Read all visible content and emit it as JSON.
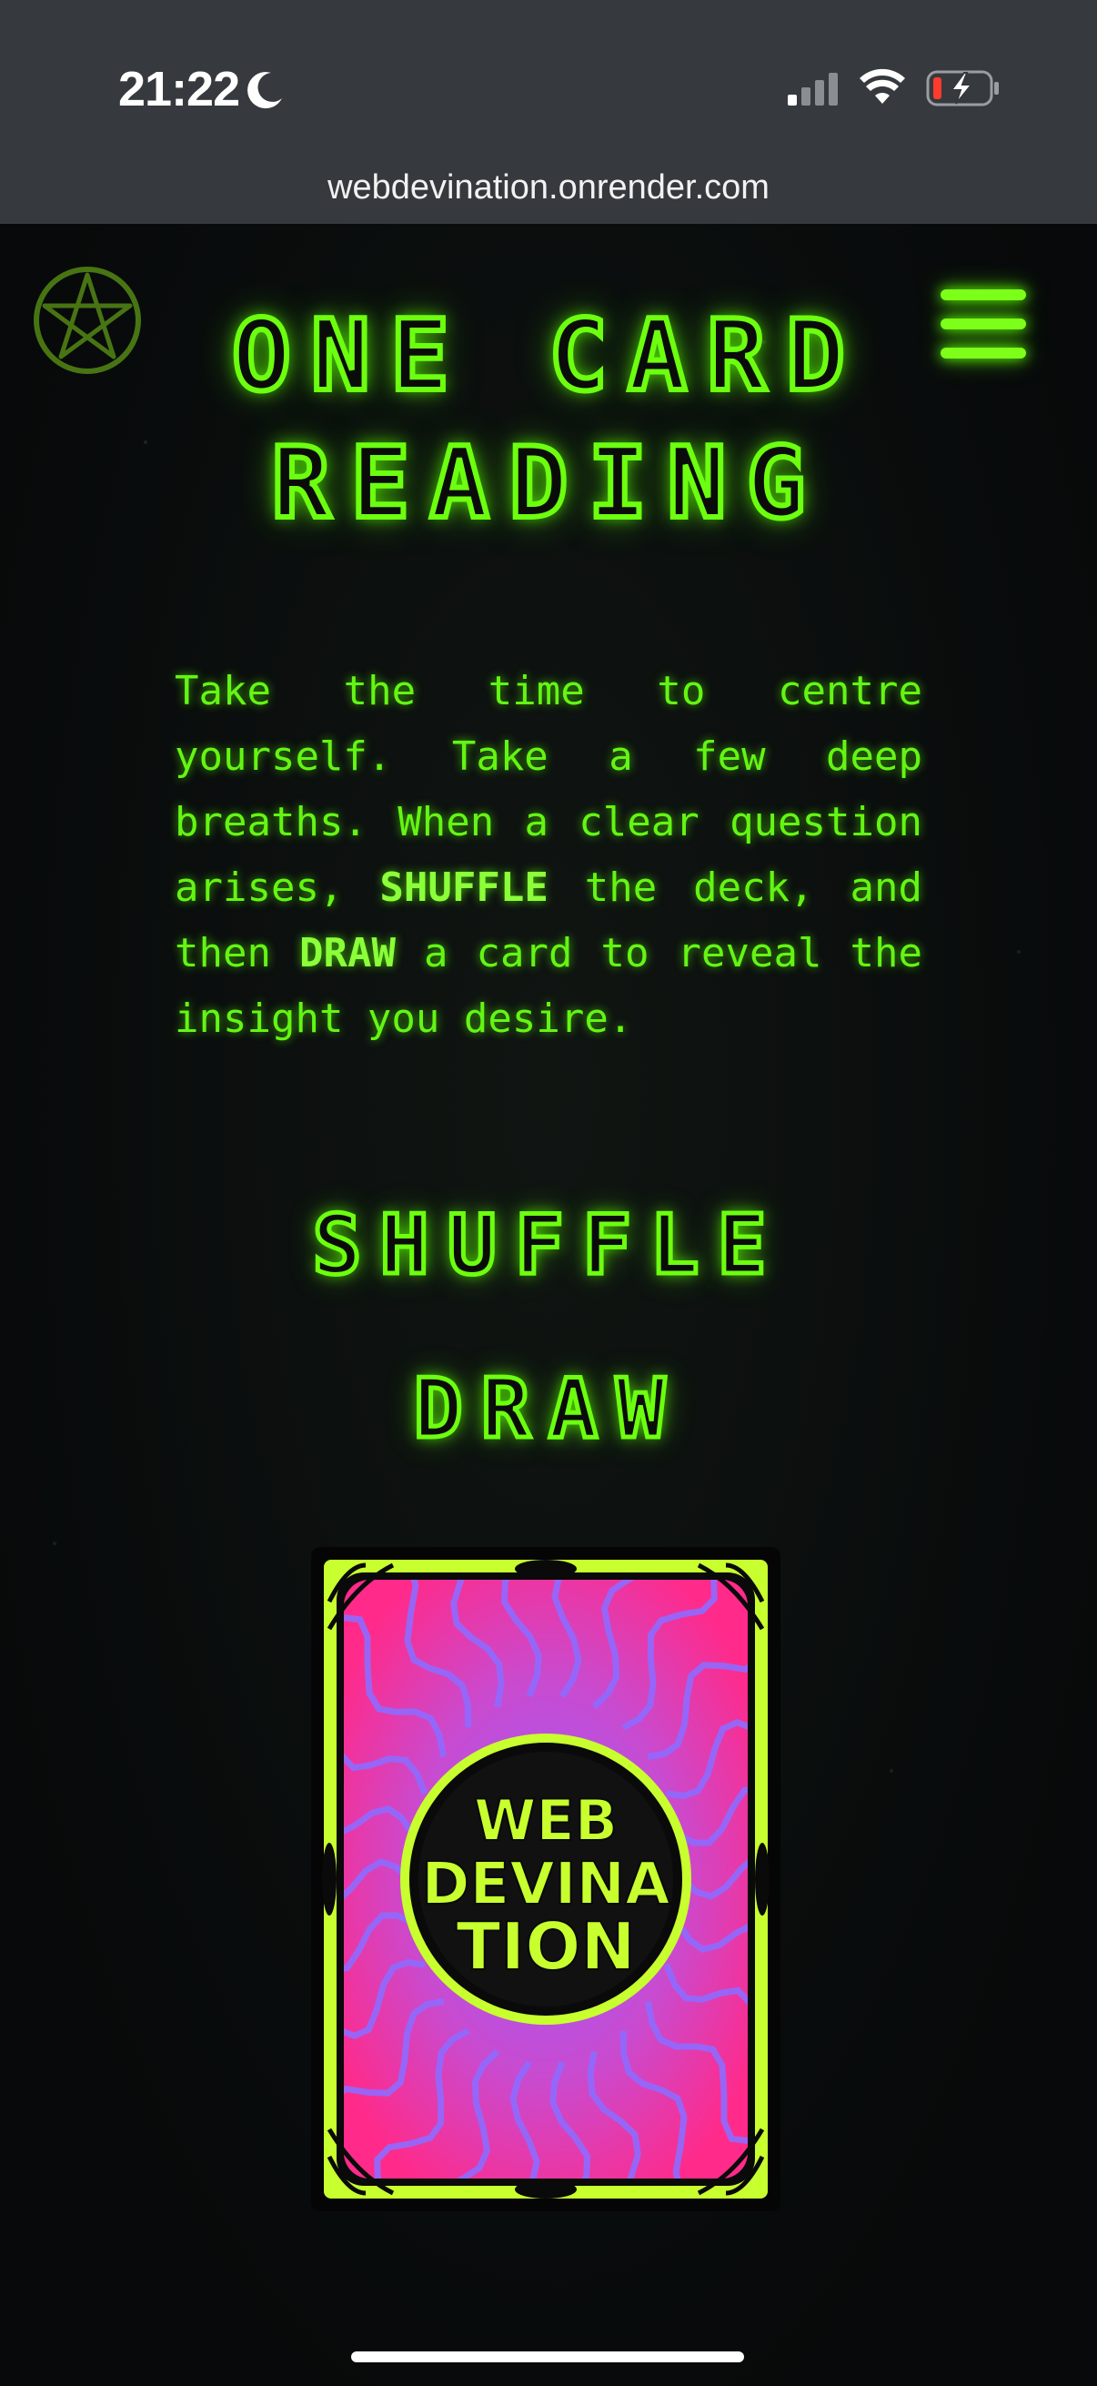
{
  "status_bar": {
    "time": "21:22",
    "moon_icon": "moon-icon",
    "signal_icon": "signal-icon",
    "wifi_icon": "wifi-icon",
    "battery_icon": "battery-charging-icon",
    "battery_level": 0.15
  },
  "browser": {
    "url": "webdevination.onrender.com"
  },
  "header": {
    "logo_icon": "pentagram-icon",
    "menu_icon": "hamburger-menu-icon",
    "title_line1": "ONE CARD",
    "title_line2": "READING"
  },
  "intro": {
    "part1": "Take the time to centre yourself. Take a few deep breaths. When a clear question arises, ",
    "shuffle_word": "SHUFFLE",
    "part2": " the deck, and then ",
    "draw_word": "DRAW",
    "part3": " a card to reveal the insight you desire."
  },
  "actions": {
    "shuffle_label": "SHUFFLE",
    "draw_label": "DRAW"
  },
  "card": {
    "back_logo_line1": "WEB",
    "back_logo_line2": "DEVINA",
    "back_logo_line3": "TION"
  },
  "colors": {
    "neon_green": "#6dff10",
    "card_lime": "#c8ff2e",
    "card_pink": "#ff2a8a",
    "card_violet": "#8f6bff",
    "background": "#0a0c0a"
  }
}
